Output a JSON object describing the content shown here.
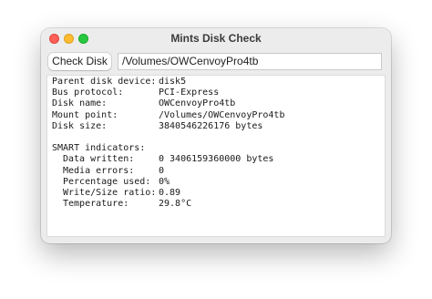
{
  "window": {
    "title": "Mints Disk Check"
  },
  "toolbar": {
    "check_disk_label": "Check Disk",
    "path_value": "/Volumes/OWCenvoyPro4tb"
  },
  "info": [
    {
      "label": "Parent disk device:",
      "value": "disk5"
    },
    {
      "label": "Bus protocol:",
      "value": "PCI-Express"
    },
    {
      "label": "Disk name:",
      "value": "OWCenvoyPro4tb"
    },
    {
      "label": "Mount point:",
      "value": "/Volumes/OWCenvoyPro4tb"
    },
    {
      "label": "Disk size:",
      "value": "3840546226176 bytes"
    }
  ],
  "smart": {
    "heading": "SMART indicators:",
    "items": [
      {
        "label": "Data written:",
        "value": "0 3406159360000 bytes"
      },
      {
        "label": "Media errors:",
        "value": "0"
      },
      {
        "label": "Percentage used:",
        "value": "0%"
      },
      {
        "label": "Write/Size ratio:",
        "value": "0.89"
      },
      {
        "label": "Temperature:",
        "value": "29.8°C"
      }
    ]
  }
}
